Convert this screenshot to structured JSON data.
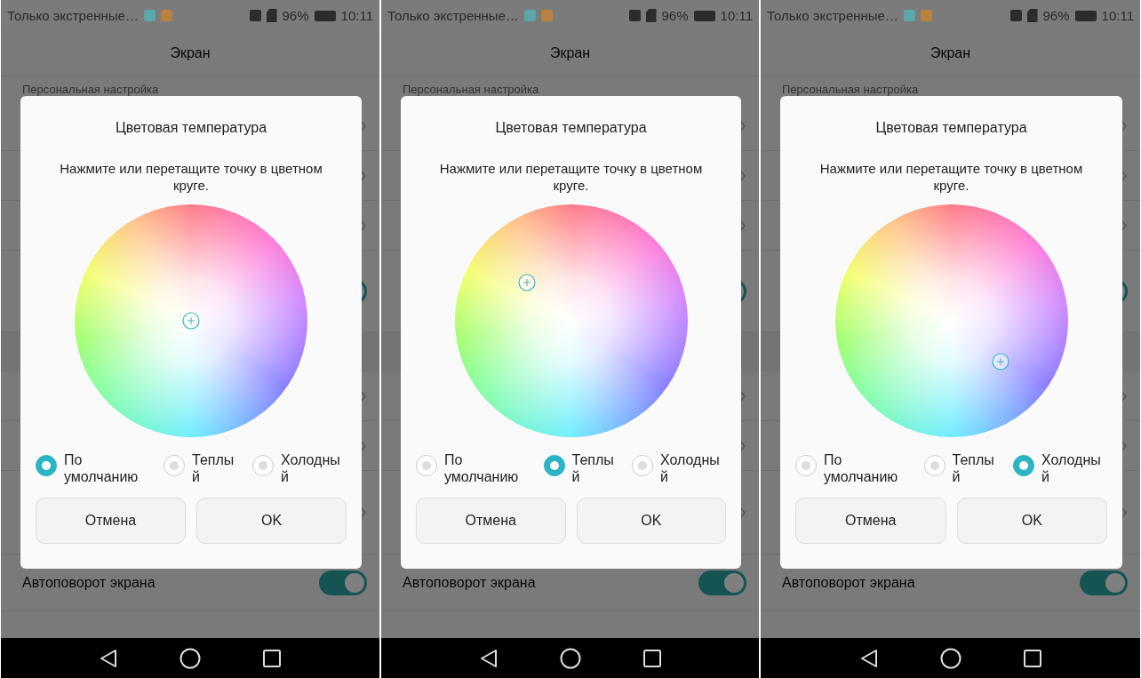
{
  "screens": [
    {
      "status_bar": {
        "notification": "Только экстренные…",
        "battery": "96%",
        "time": "10:11"
      },
      "header": {
        "title": "Экран"
      },
      "section_label": "Персональная настройка",
      "covered_switch": {
        "on": true
      },
      "setting": {
        "label": "Автоповорот экрана",
        "on": true
      },
      "dialog": {
        "title": "Цветовая температура",
        "message": "Нажмите или перетащите точку в цветном круге.",
        "options": [
          {
            "kind": "default",
            "label": "По умолчанию",
            "selected": true
          },
          {
            "kind": "warm",
            "label": "Теплый",
            "selected": false
          },
          {
            "kind": "cool",
            "label": "Холодный",
            "selected": false
          }
        ],
        "buttons": [
          "Отмена",
          "OK"
        ]
      }
    },
    {
      "status_bar": {
        "notification": "Только экстренные…",
        "battery": "96%",
        "time": "10:11"
      },
      "header": {
        "title": "Экран"
      },
      "section_label": "Персональная настройка",
      "covered_switch": {
        "on": true
      },
      "setting": {
        "label": "Автоповорот экрана",
        "on": true
      },
      "dialog": {
        "title": "Цветовая температура",
        "message": "Нажмите или перетащите точку в цветном круге.",
        "options": [
          {
            "kind": "default",
            "label": "По умолчанию",
            "selected": false
          },
          {
            "kind": "warm",
            "label": "Теплый",
            "selected": true
          },
          {
            "kind": "cool",
            "label": "Холодный",
            "selected": false
          }
        ],
        "buttons": [
          "Отмена",
          "OK"
        ]
      }
    },
    {
      "status_bar": {
        "notification": "Только экстренные…",
        "battery": "96%",
        "time": "10:11"
      },
      "header": {
        "title": "Экран"
      },
      "section_label": "Персональная настройка",
      "covered_switch": {
        "on": true
      },
      "setting": {
        "label": "Автоповорот экрана",
        "on": true
      },
      "dialog": {
        "title": "Цветовая температура",
        "message": "Нажмите или перетащите точку в цветном круге.",
        "options": [
          {
            "kind": "default",
            "label": "По умолчанию",
            "selected": false
          },
          {
            "kind": "warm",
            "label": "Теплый",
            "selected": false
          },
          {
            "kind": "cool",
            "label": "Холодный",
            "selected": true
          }
        ],
        "buttons": [
          "Отмена",
          "OK"
        ]
      }
    }
  ]
}
